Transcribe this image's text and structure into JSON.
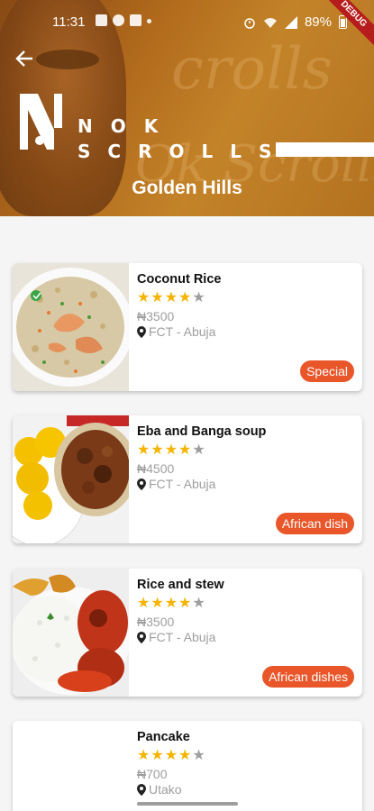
{
  "status_bar": {
    "time": "11:31",
    "battery": "89%"
  },
  "debug_banner": "DEBUG",
  "header": {
    "background_script_1": "crolls",
    "background_script_2": "Ok Scrolls",
    "logo_top": "NOK",
    "logo_bottom": "SCROLLS",
    "location_title": "Golden Hills"
  },
  "colors": {
    "accent": "#e8562a",
    "star": "#f4b400",
    "star_empty": "#9e9e9e",
    "header_brown": "#b26a1c"
  },
  "dishes": [
    {
      "name": "Coconut Rice",
      "rating": 4,
      "price": "₦3500",
      "location": "FCT - Abuja",
      "tag": "Special",
      "image_icon": "coconut-rice-image"
    },
    {
      "name": "Eba and Banga soup",
      "rating": 4,
      "price": "₦4500",
      "location": "FCT - Abuja",
      "tag": "African dish",
      "image_icon": "eba-banga-image"
    },
    {
      "name": "Rice and stew",
      "rating": 4,
      "price": "₦3500",
      "location": "FCT - Abuja",
      "tag": "African dishes",
      "image_icon": "rice-stew-image"
    },
    {
      "name": "Pancake",
      "rating": 4,
      "price": "₦700",
      "location": "Utako",
      "tag": "",
      "image_icon": "pancake-image"
    }
  ]
}
